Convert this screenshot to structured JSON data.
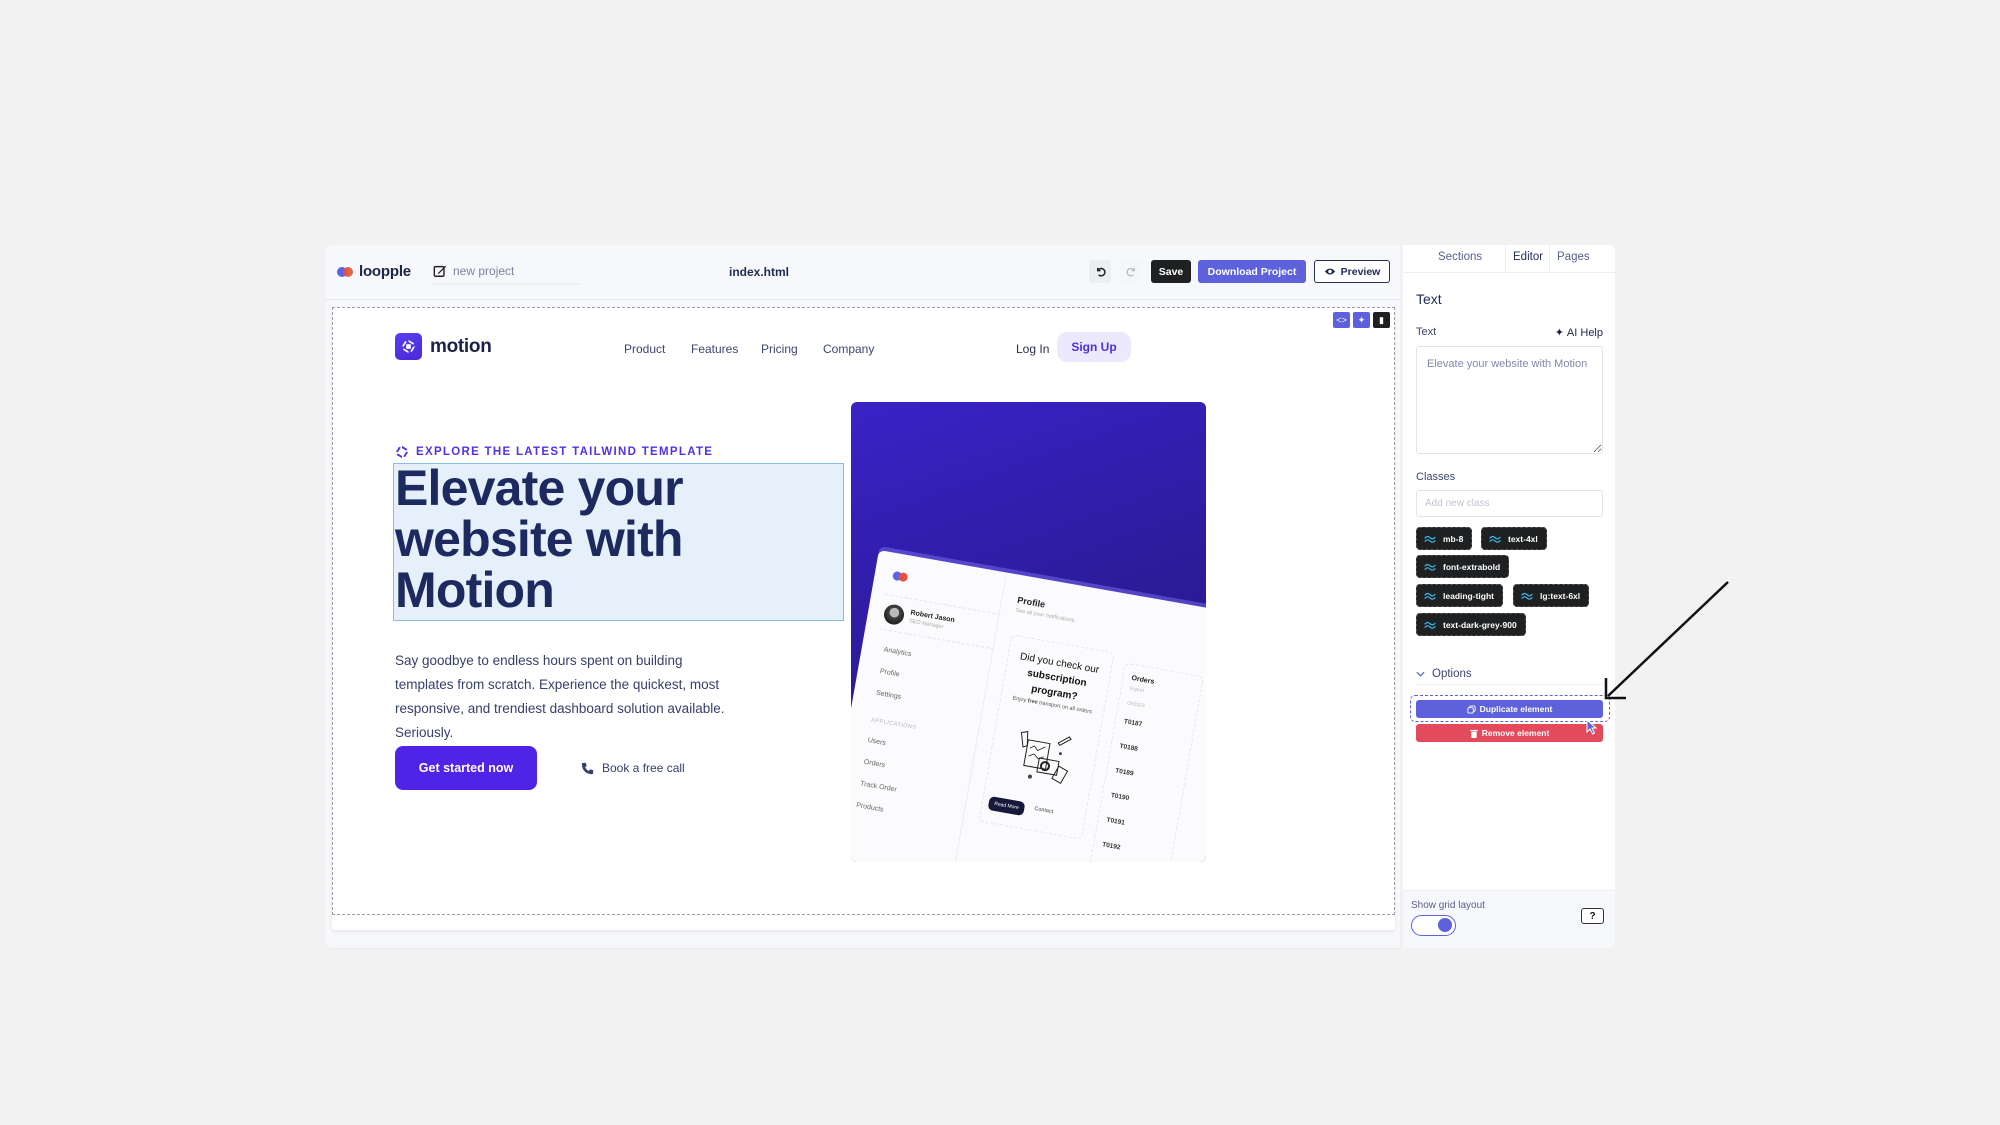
{
  "app": {
    "brand": "loopple",
    "project_name": "new project",
    "file_name": "index.html",
    "toolbar": {
      "undo_icon": "undo-icon",
      "redo_icon": "redo-icon",
      "save_label": "Save",
      "download_label": "Download Project",
      "preview_label": "Preview",
      "preview_icon": "eye-icon"
    }
  },
  "canvas": {
    "section_tools": [
      "code-icon",
      "add-layer-icon",
      "trash-icon"
    ],
    "site": {
      "logo_name": "motion",
      "nav": [
        "Product",
        "Features",
        "Pricing",
        "Company"
      ],
      "login_label": "Log In",
      "signup_label": "Sign Up",
      "eyebrow": "EXPLORE THE LATEST TAILWIND TEMPLATE",
      "headline": "Elevate your website with Motion",
      "lead": "Say goodbye to endless hours spent on building templates from scratch. Experience the quickest, most responsive, and trendiest dashboard solution available. Seriously.",
      "cta_label": "Get started now",
      "call_label": "Book a free call",
      "mockup": {
        "user_name": "Robert Jason",
        "user_role": "SEO Manager",
        "menu": [
          "Analytics",
          "Profile",
          "Settings"
        ],
        "category": "APPLICATIONS",
        "app_menu": [
          "Users",
          "Orders",
          "Track Order",
          "Products"
        ],
        "main_title": "Profile",
        "main_subtitle": "See all your notifications",
        "card_title_1": "Did you check our",
        "card_title_2": "subscription",
        "card_title_3": "program?",
        "card_sub_pre": "Enjoy ",
        "card_sub_bold": "free",
        "card_sub_post": " transport on all orders",
        "read_more": "Read More",
        "contact": "Contact",
        "orders_title": "Orders",
        "orders_sub": "Export",
        "orders_head": "ORDER",
        "orders": [
          "T0187",
          "T0188",
          "T0189",
          "T0190",
          "T0191",
          "T0192"
        ]
      }
    }
  },
  "panel": {
    "tabs": [
      "Sections",
      "Editor",
      "Pages"
    ],
    "active_tab": "Editor",
    "heading": "Text",
    "text_label": "Text",
    "ai_help_label": "AI Help",
    "text_value": "Elevate your website with Motion",
    "classes_label": "Classes",
    "class_placeholder": "Add new class",
    "classes": [
      "mb-8",
      "text-4xl",
      "font-extrabold",
      "leading-tight",
      "lg:text-6xl",
      "text-dark-grey-900"
    ],
    "options_label": "Options",
    "duplicate_label": "Duplicate element",
    "remove_label": "Remove element",
    "grid_layout_label": "Show grid layout",
    "grid_layout_on": true,
    "help_label": "?"
  },
  "colors": {
    "accent": "#5d62dc",
    "brand_purple": "#4f24e6",
    "danger": "#e34a5c",
    "dark": "#1e2022",
    "headline": "#1d2a60"
  }
}
